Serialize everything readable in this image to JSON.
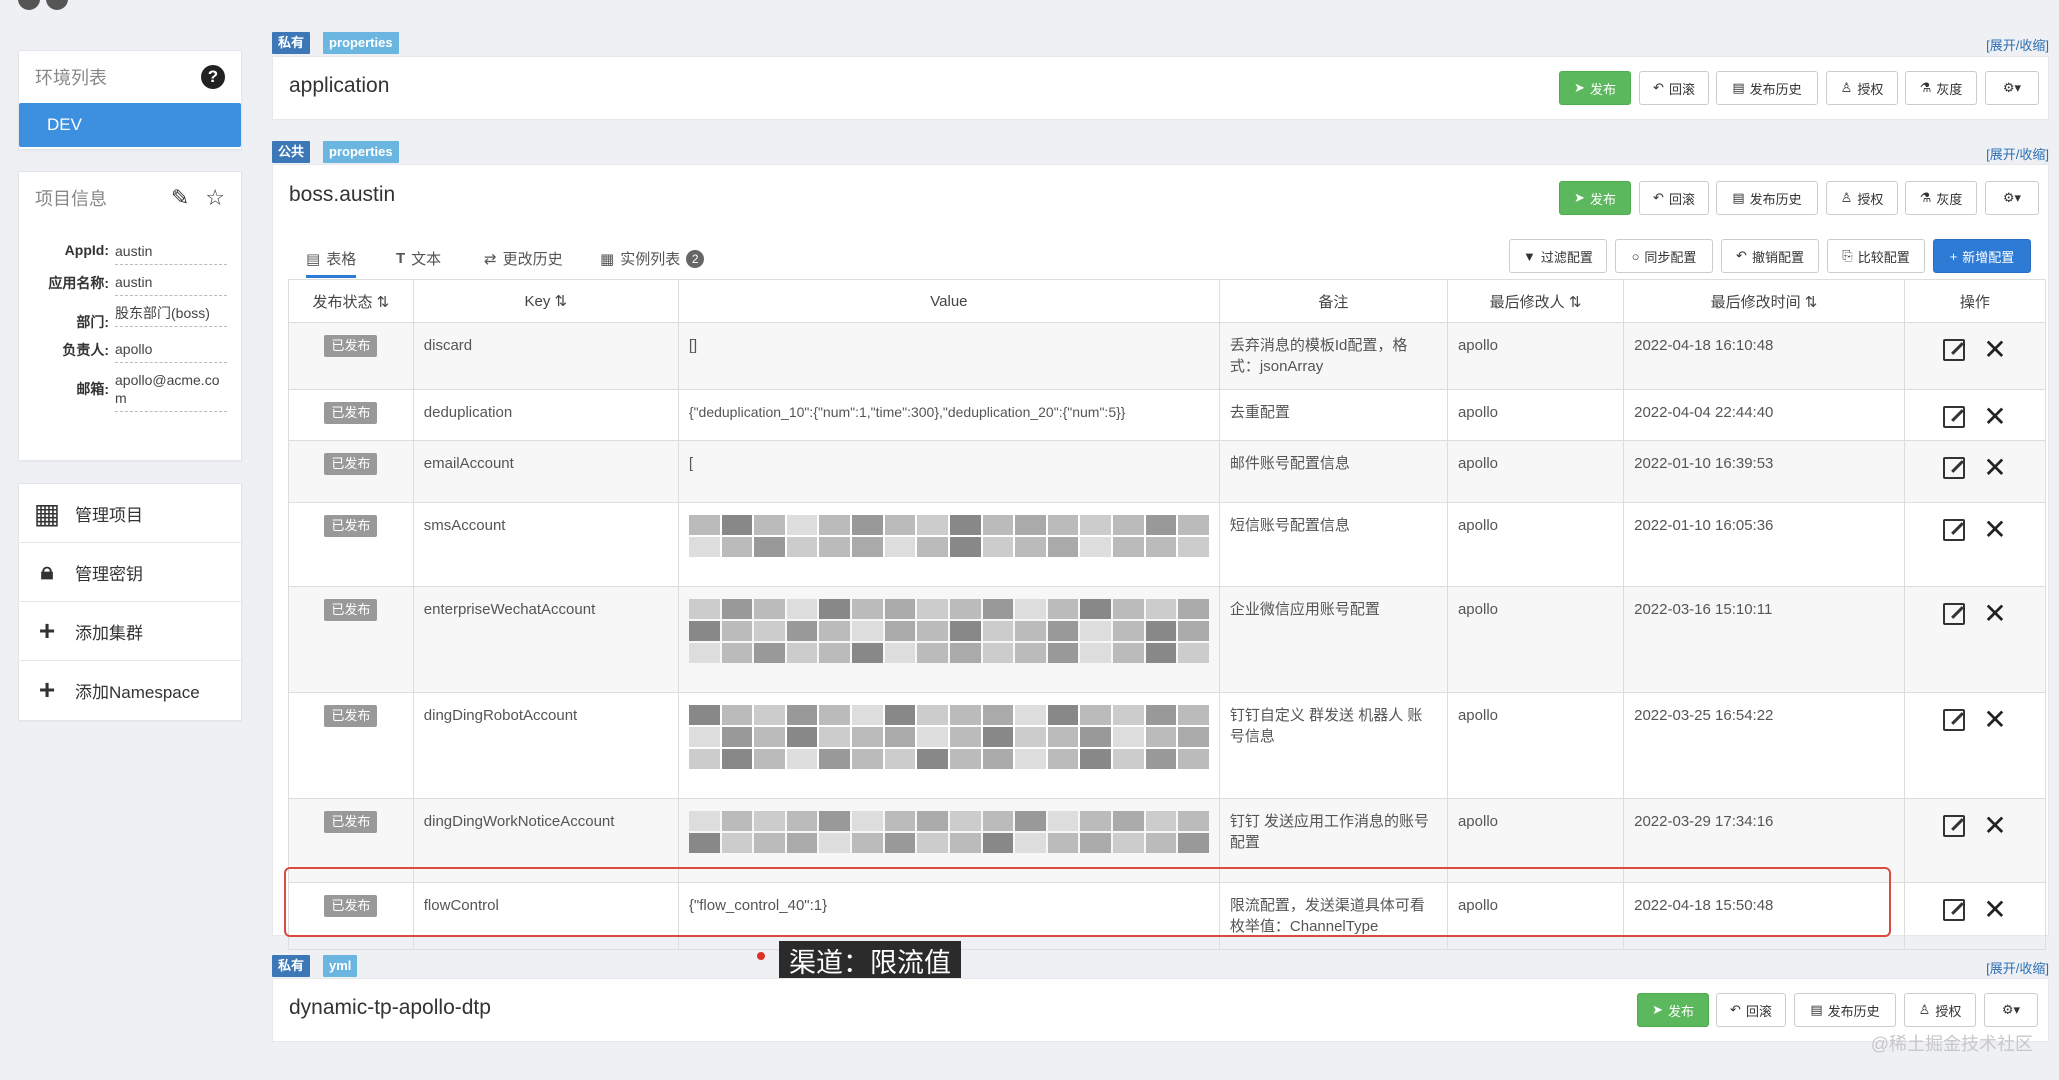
{
  "env": {
    "title": "环境列表",
    "active": "DEV"
  },
  "project": {
    "title": "项目信息",
    "fields": [
      {
        "k": "AppId:",
        "v": "austin"
      },
      {
        "k": "应用名称:",
        "v": "austin"
      },
      {
        "k": "部门:",
        "v": "股东部门(boss)"
      },
      {
        "k": "负责人:",
        "v": "apollo"
      },
      {
        "k": "邮箱:",
        "v": "apollo@acme.com"
      }
    ]
  },
  "menu": [
    {
      "label": "管理项目"
    },
    {
      "label": "管理密钥"
    },
    {
      "label": "添加集群"
    },
    {
      "label": "添加Namespace"
    }
  ],
  "expand_label": "[展开/收缩]",
  "actions": {
    "publish": "发布",
    "rollback": "回滚",
    "history": "发布历史",
    "grant": "授权",
    "gray": "灰度"
  },
  "ns1": {
    "scope": "私有",
    "format": "properties",
    "name": "application"
  },
  "ns2": {
    "scope": "公共",
    "format": "properties",
    "name": "boss.austin"
  },
  "ns3": {
    "scope": "私有",
    "format": "yml",
    "name": "dynamic-tp-apollo-dtp"
  },
  "tabs": {
    "table": "表格",
    "text": "文本",
    "history": "更改历史",
    "instances": "实例列表",
    "instances_count": "2"
  },
  "tools": {
    "filter": "过滤配置",
    "sync": "同步配置",
    "revoke": "撤销配置",
    "compare": "比较配置",
    "add": "新增配置"
  },
  "columns": [
    "发布状态",
    "Key",
    "Value",
    "备注",
    "最后修改人",
    "最后修改时间",
    "操作"
  ],
  "rows": [
    {
      "status": "已发布",
      "key": "discard",
      "value": "[]",
      "note": "丢弃消息的模板Id配置，格式：jsonArray",
      "user": "apollo",
      "time": "2022-04-18 16:10:48"
    },
    {
      "status": "已发布",
      "key": "deduplication",
      "value": "{\"deduplication_10\":{\"num\":1,\"time\":300},\"deduplication_20\":{\"num\":5}}",
      "note": "去重配置",
      "user": "apollo",
      "time": "2022-04-04 22:44:40"
    },
    {
      "status": "已发布",
      "key": "emailAccount",
      "value": "[",
      "note": "邮件账号配置信息",
      "user": "apollo",
      "time": "2022-01-10 16:39:53"
    },
    {
      "status": "已发布",
      "key": "smsAccount",
      "value": "",
      "note": "短信账号配置信息",
      "user": "apollo",
      "time": "2022-01-10 16:05:36"
    },
    {
      "status": "已发布",
      "key": "enterpriseWechatAccount",
      "value": "",
      "note": "企业微信应用账号配置",
      "user": "apollo",
      "time": "2022-03-16 15:10:11"
    },
    {
      "status": "已发布",
      "key": "dingDingRobotAccount",
      "value": "",
      "note": "钉钉自定义 群发送 机器人 账号信息",
      "user": "apollo",
      "time": "2022-03-25 16:54:22"
    },
    {
      "status": "已发布",
      "key": "dingDingWorkNoticeAccount",
      "value": "",
      "note": "钉钉 发送应用工作消息的账号配置",
      "user": "apollo",
      "time": "2022-03-29 17:34:16"
    },
    {
      "status": "已发布",
      "key": "flowControl",
      "value": "{\"flow_control_40\":1}",
      "note": "限流配置，发送渠道具体可看枚举值：ChannelType",
      "user": "apollo",
      "time": "2022-04-18 15:50:48"
    }
  ],
  "annotation": "渠道：限流值",
  "watermark": "@稀土掘金技术社区"
}
